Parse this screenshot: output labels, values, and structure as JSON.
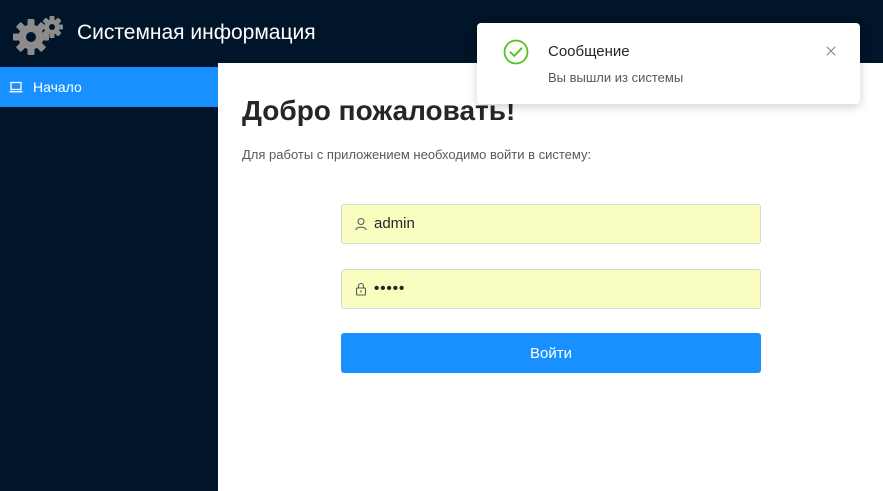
{
  "header": {
    "title": "Системная информация"
  },
  "sidebar": {
    "items": [
      {
        "label": "Начало",
        "icon": "laptop-icon",
        "active": true
      }
    ]
  },
  "main": {
    "title": "Добро пожаловать!",
    "subtitle": "Для работы с приложением необходимо войти в систему:",
    "username": {
      "value": "admin",
      "icon": "user-icon"
    },
    "password": {
      "value": "•••••",
      "icon": "lock-icon"
    },
    "login_button": "Войти"
  },
  "notification": {
    "title": "Сообщение",
    "message": "Вы вышли из системы",
    "icon": "check-circle-icon"
  },
  "colors": {
    "header_bg": "#001529",
    "accent": "#1890ff",
    "autofill_bg": "#fafdc0",
    "success": "#52c41a"
  }
}
